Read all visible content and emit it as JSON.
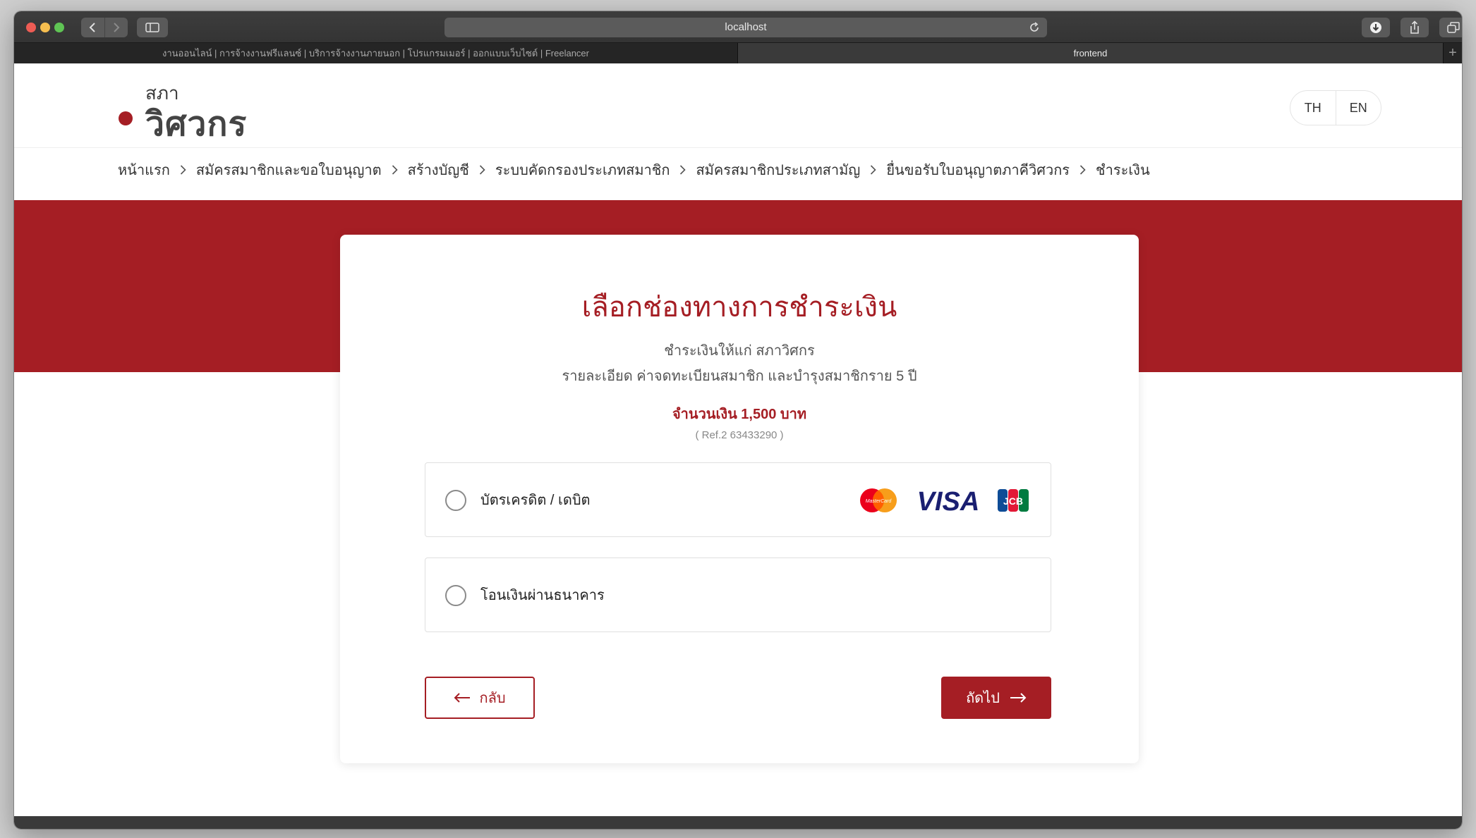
{
  "browser": {
    "address": "localhost",
    "tabs": [
      {
        "label": "งานออนไลน์ | การจ้างงานฟรีแลนซ์ | บริการจ้างงานภายนอก | โปรแกรมเมอร์ | ออกแบบเว็บไซต์ | Freelancer",
        "active": false
      },
      {
        "label": "frontend",
        "active": true
      }
    ],
    "new_tab": "+"
  },
  "header": {
    "logo_small": "สภา",
    "logo_big": "วิศวกร",
    "lang": [
      "TH",
      "EN"
    ]
  },
  "breadcrumb": [
    "หน้าแรก",
    "สมัครสมาชิกและขอใบอนุญาต",
    "สร้างบัญชี",
    "ระบบคัดกรองประเภทสมาชิก",
    "สมัครสมาชิกประเภทสามัญ",
    "ยื่นขอรับใบอนุญาตภาคีวิศวกร",
    "ชำระเงิน"
  ],
  "card": {
    "title": "เลือกช่องทางการชำระเงิน",
    "pay_to": "ชำระเงินให้แก่ สภาวิศกร",
    "detail": "รายละเอียด ค่าจดทะเบียนสมาชิก และบำรุงสมาชิกราย 5 ปี",
    "amount": "จำนวนเงิน 1,500 บาท",
    "ref": "( Ref.2 63433290 )",
    "options": [
      {
        "label": "บัตรเครดิต / เดบิต",
        "logos": [
          "MasterCard",
          "VISA",
          "JCB"
        ]
      },
      {
        "label": "โอนเงินผ่านธนาคาร"
      }
    ],
    "back_label": "กลับ",
    "next_label": "ถัดไป"
  },
  "colors": {
    "brand": "#a51e24",
    "chrome": "#3a3a3a"
  }
}
